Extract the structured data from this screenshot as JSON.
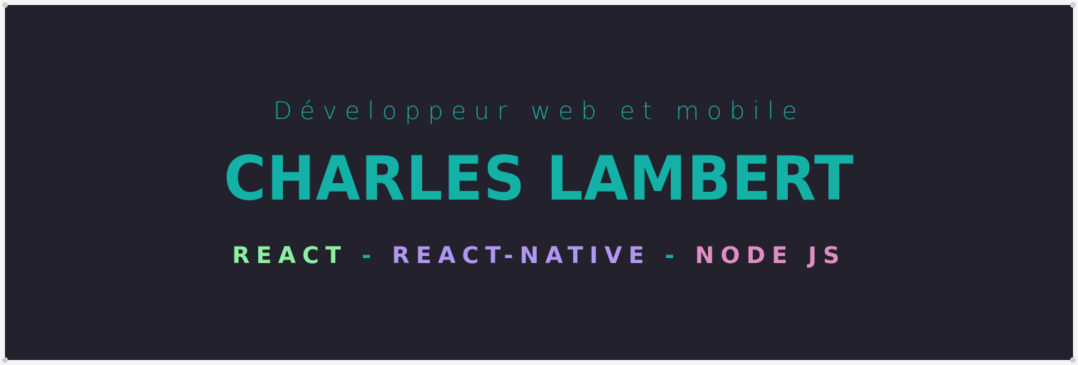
{
  "subtitle": "Développeur web et mobile",
  "name": "CHARLES LAMBERT",
  "skills": {
    "first": "REACT",
    "separator": "-",
    "second": "REACT-NATIVE",
    "third": "NODE JS"
  },
  "colors": {
    "background": "#22212c",
    "accent": "#14b1a7",
    "react": "#8ff0a4",
    "react_native": "#b197f2",
    "node": "#e08ec4"
  }
}
